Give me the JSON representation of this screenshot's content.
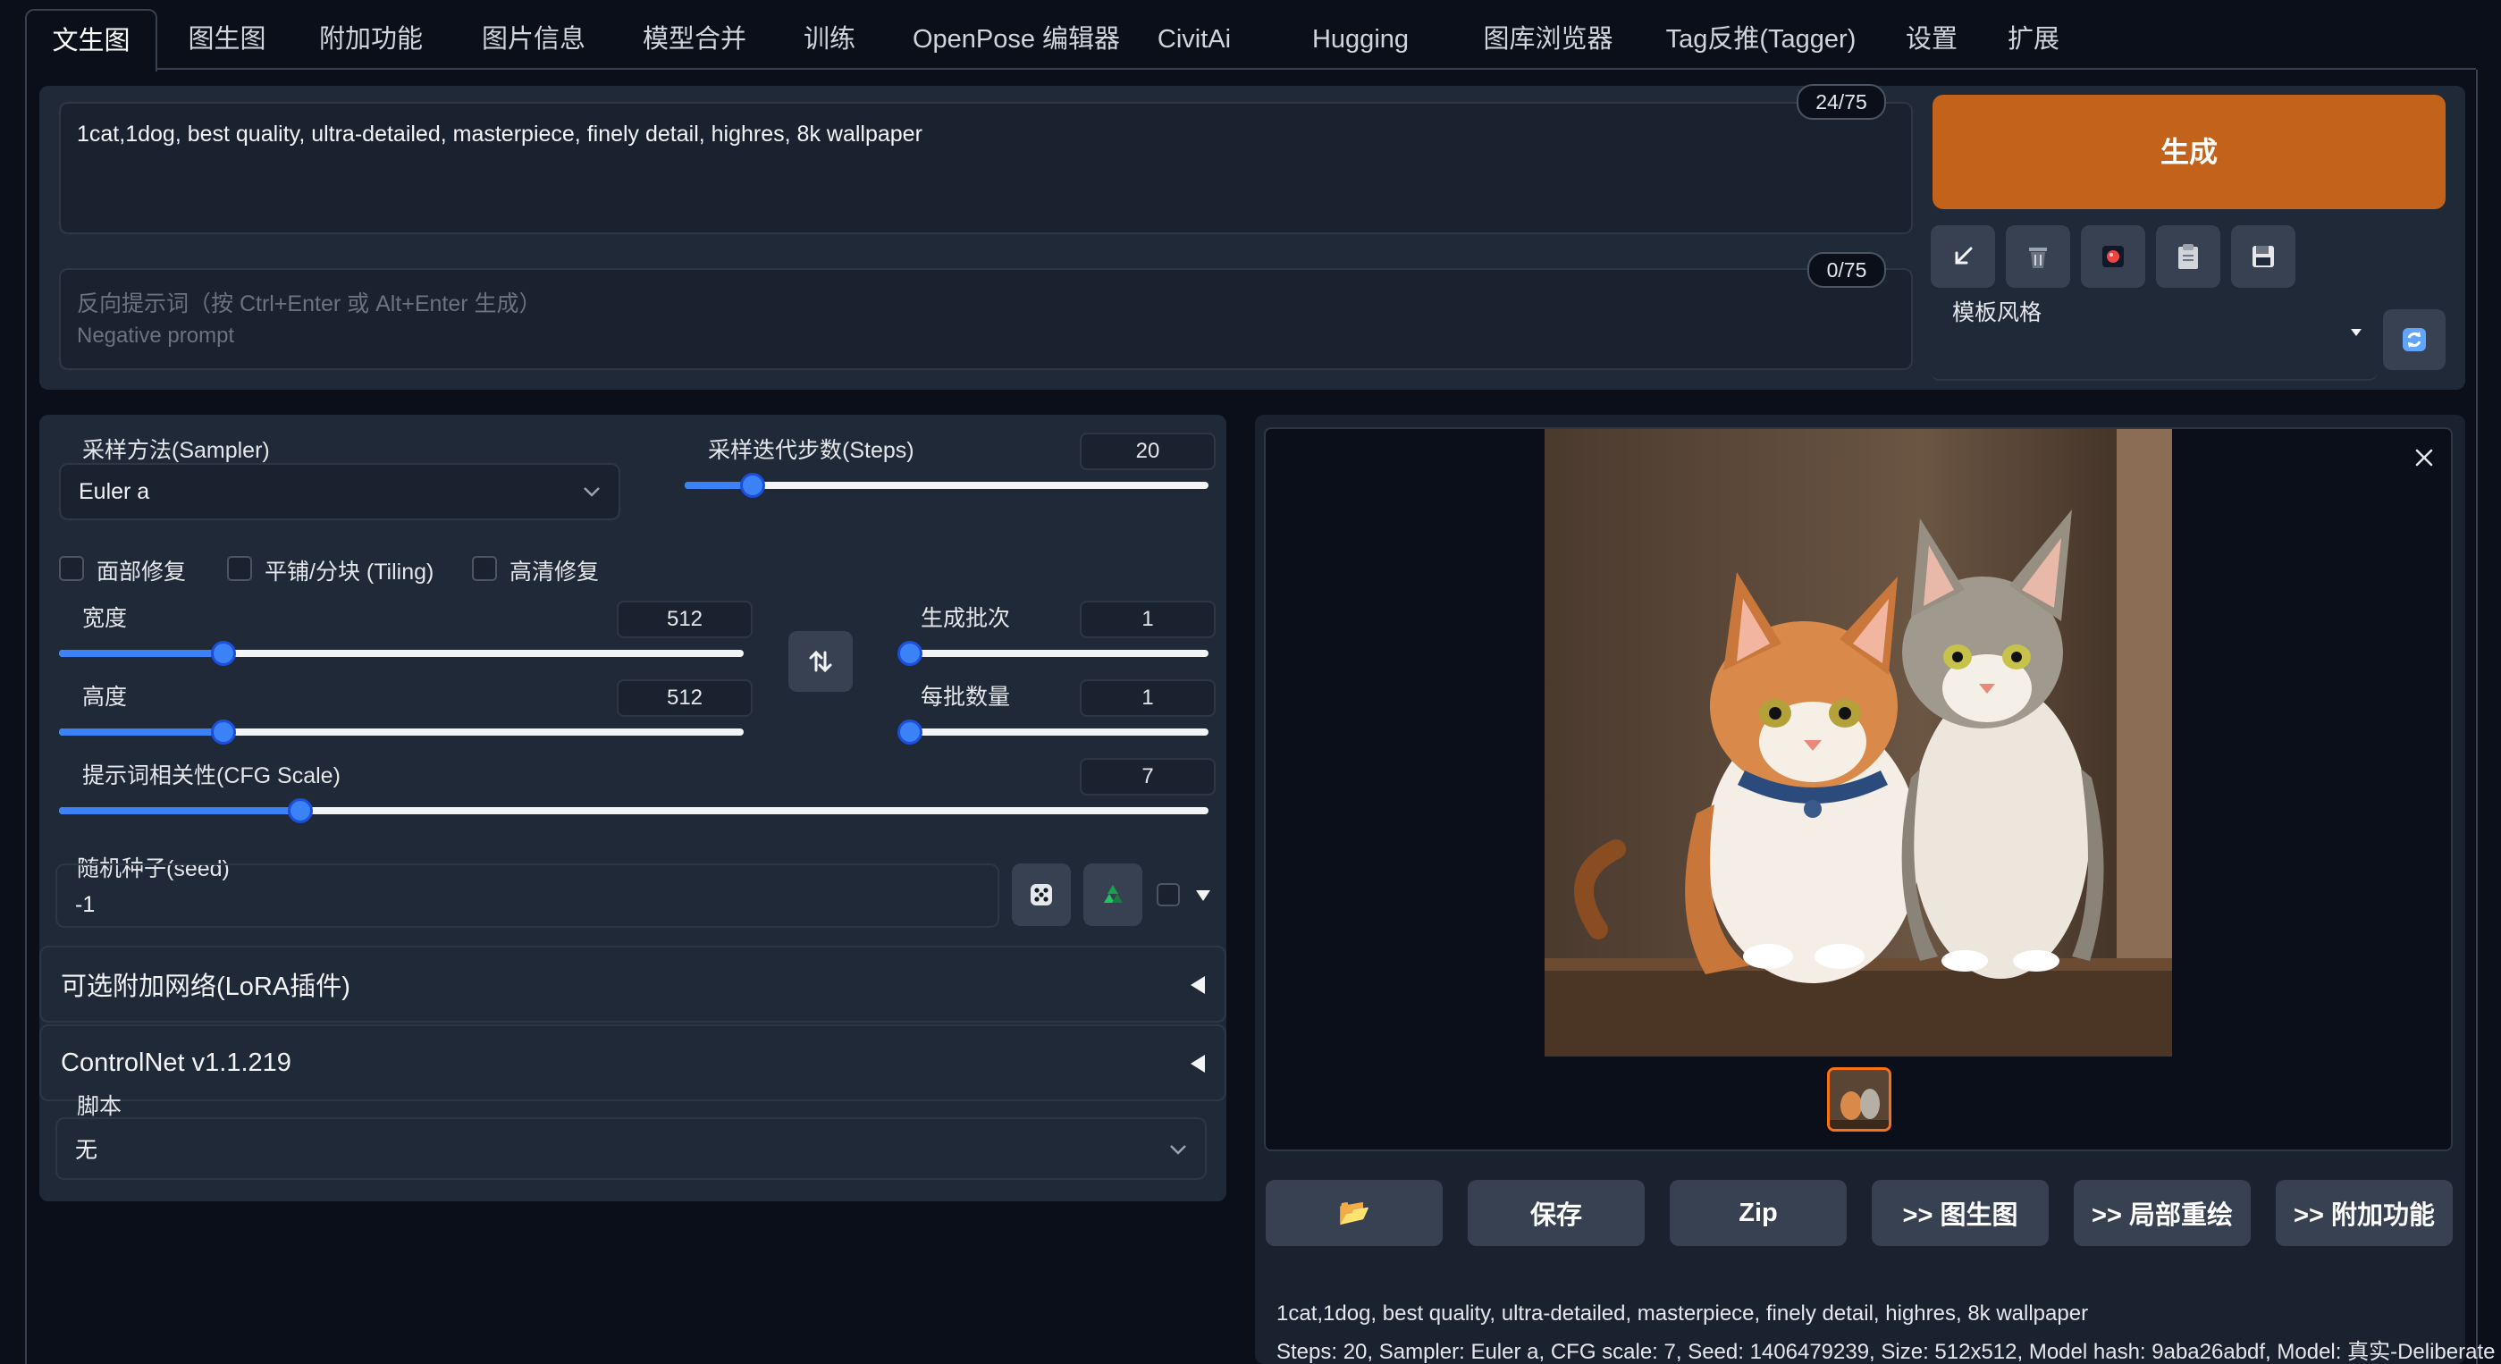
{
  "tabs": [
    {
      "label": "文生图",
      "active": true
    },
    {
      "label": "图生图"
    },
    {
      "label": "附加功能"
    },
    {
      "label": "图片信息"
    },
    {
      "label": "模型合并"
    },
    {
      "label": "训练"
    },
    {
      "label": "OpenPose 编辑器"
    },
    {
      "label": "CivitAi"
    },
    {
      "label": "Hugging Face"
    },
    {
      "label": "图库浏览器"
    },
    {
      "label": "Tag反推(Tagger)"
    },
    {
      "label": "设置"
    },
    {
      "label": "扩展"
    }
  ],
  "prompt": {
    "value": "1cat,1dog, best quality, ultra-detailed, masterpiece, finely detail, highres, 8k wallpaper",
    "counter": "24/75"
  },
  "negative_prompt": {
    "placeholder_line1": "反向提示词（按 Ctrl+Enter 或 Alt+Enter 生成）",
    "placeholder_line2": "Negative prompt",
    "counter": "0/75"
  },
  "generate_label": "生成",
  "toolbar_icons": [
    "arrow-icon",
    "trash-icon",
    "red-dot-icon",
    "clipboard-icon",
    "save-disk-icon"
  ],
  "styles": {
    "label": "模板风格",
    "value": ""
  },
  "sampler": {
    "label": "采样方法(Sampler)",
    "value": "Euler a"
  },
  "steps": {
    "label": "采样迭代步数(Steps)",
    "value": "20",
    "fraction": 0.13
  },
  "checkboxes": {
    "face": "面部修复",
    "tiling": "平铺/分块 (Tiling)",
    "hires": "高清修复"
  },
  "width": {
    "label": "宽度",
    "value": "512",
    "fraction": 0.24
  },
  "height": {
    "label": "高度",
    "value": "512",
    "fraction": 0.24
  },
  "batch_count": {
    "label": "生成批次",
    "value": "1",
    "fraction": 0.0
  },
  "batch_size": {
    "label": "每批数量",
    "value": "1",
    "fraction": 0.0
  },
  "cfg": {
    "label": "提示词相关性(CFG Scale)",
    "value": "7",
    "fraction": 0.21
  },
  "seed": {
    "label": "随机种子(seed)",
    "value": "-1"
  },
  "lora_label": "可选附加网络(LoRA插件)",
  "controlnet_label": "ControlNet v1.1.219",
  "script": {
    "label": "脚本",
    "value": "无"
  },
  "output_buttons": [
    "📂",
    "保存",
    "Zip",
    ">> 图生图",
    ">> 局部重绘",
    ">> 附加功能"
  ],
  "output_info": {
    "line1": "1cat,1dog, best quality, ultra-detailed, masterpiece, finely detail, highres, 8k wallpaper",
    "line2": "Steps: 20, Sampler: Euler a, CFG scale: 7, Seed: 1406479239, Size: 512x512, Model hash: 9aba26abdf, Model: 真实-Deliberate"
  },
  "colors": {
    "accent": "#3b82f6",
    "generate": "#c2621b",
    "background": "#0b0f19",
    "panel": "#1f2937"
  }
}
